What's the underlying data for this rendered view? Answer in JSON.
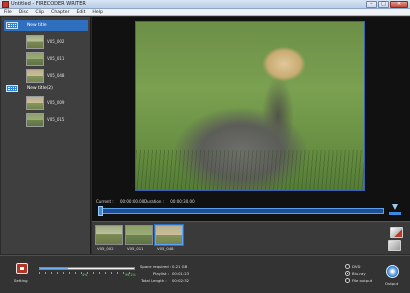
{
  "window": {
    "title": "Untitled - FIRECODER WRITER",
    "controls": {
      "minimize": "–",
      "maximize": "□",
      "close": "✕"
    }
  },
  "menu": [
    "File",
    "Disc",
    "Clip",
    "Chapter",
    "Edit",
    "Help"
  ],
  "titles": [
    {
      "label": "New title",
      "selected": true,
      "chapters": [
        {
          "label": "V05_002"
        },
        {
          "label": "V05_011"
        },
        {
          "label": "V05_048"
        }
      ]
    },
    {
      "label": "New title(2)",
      "selected": false,
      "chapters": [
        {
          "label": "V05_009"
        },
        {
          "label": "V05_015"
        }
      ]
    }
  ],
  "preview": {
    "current_label": "Current :",
    "current_value": "00:00:00.00",
    "duration_label": "Duration :",
    "duration_value": "00:00:30.00"
  },
  "clips": [
    {
      "label": "V05_002",
      "selected": false
    },
    {
      "label": "V05_011",
      "selected": false
    },
    {
      "label": "V05_048",
      "selected": true
    }
  ],
  "status": {
    "setting_label": "Setting",
    "space_label": "Space required :",
    "space_value": "0.21 GB",
    "playlist_label": "Playlist :",
    "playlist_value": "00:01:23",
    "total_label": "Total Length :",
    "total_value": "00:02:32",
    "percent_left": "4%",
    "percent_right": "99.1%",
    "capacity_fraction": 0.3
  },
  "output_options": [
    {
      "label": "DVD",
      "checked": false
    },
    {
      "label": "Blu-ray",
      "checked": true
    },
    {
      "label": "File output",
      "checked": false
    }
  ],
  "output_label": "Output",
  "colors": {
    "accent_blue": "#2f6fbf",
    "seek_blue": "#1e4f96",
    "settings_red": "#b23525"
  }
}
